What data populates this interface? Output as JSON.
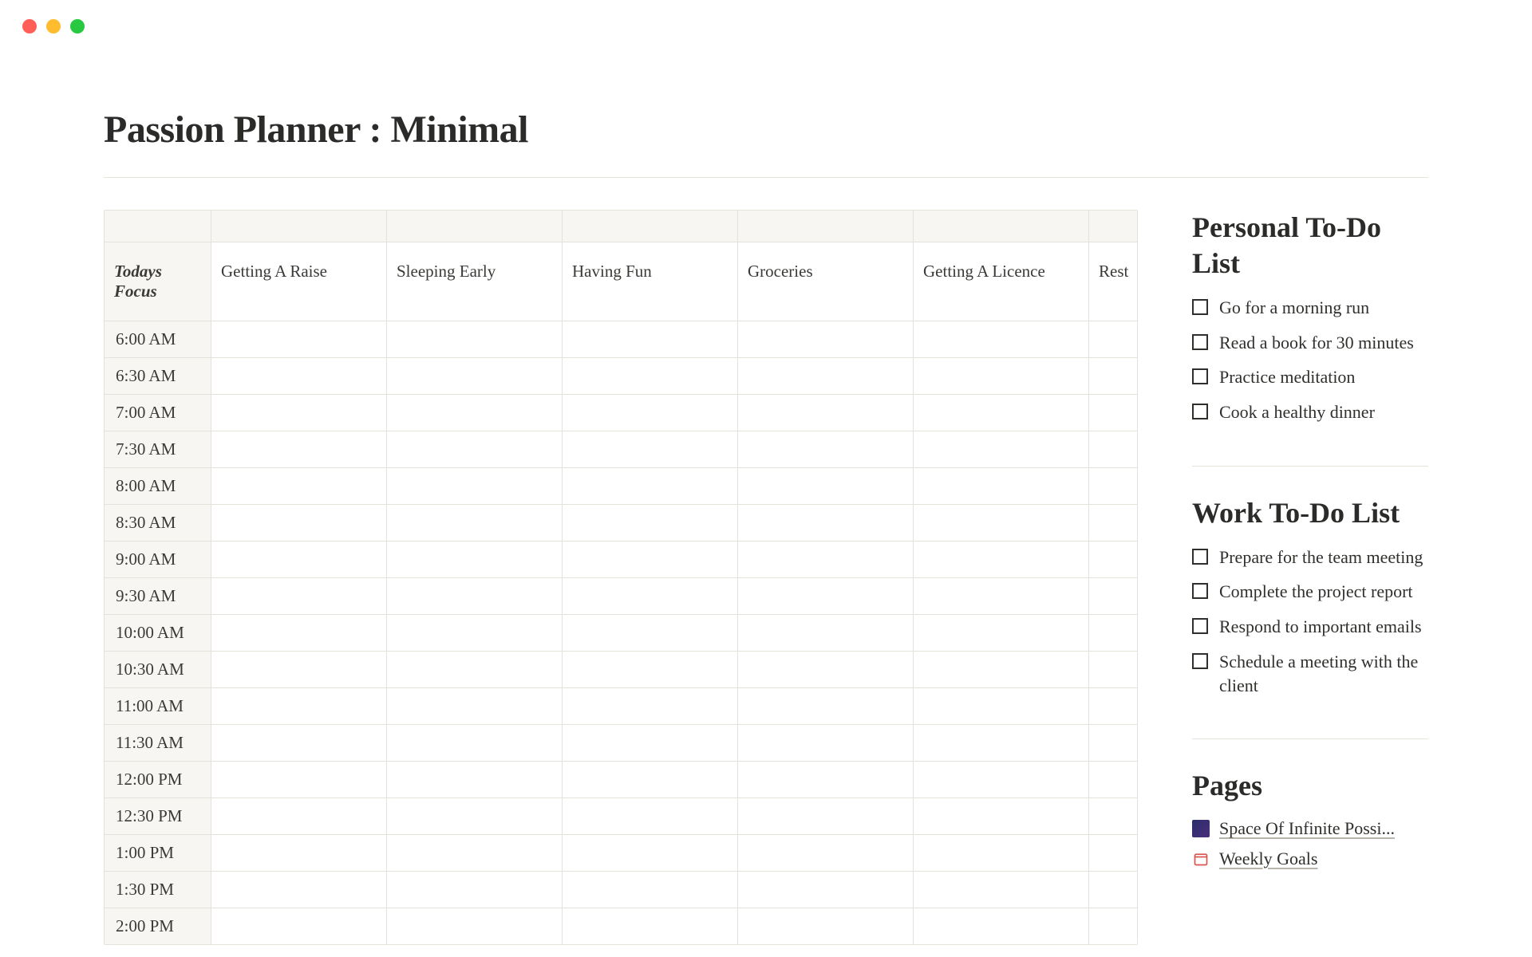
{
  "page": {
    "title": "Passion Planner : Minimal"
  },
  "schedule": {
    "focusLabel": "Todays Focus",
    "columns": [
      "Getting A Raise",
      "Sleeping Early",
      "Having Fun",
      "Groceries",
      "Getting A Licence",
      "Rest"
    ],
    "times": [
      "6:00 AM",
      "6:30 AM",
      "7:00 AM",
      "7:30 AM",
      "8:00 AM",
      "8:30 AM",
      "9:00 AM",
      "9:30 AM",
      "10:00 AM",
      "10:30 AM",
      "11:00 AM",
      "11:30 AM",
      "12:00 PM",
      "12:30 PM",
      "1:00 PM",
      "1:30 PM",
      "2:00 PM"
    ]
  },
  "personal": {
    "title": "Personal To-Do List",
    "items": [
      "Go for a morning run",
      "Read a book for 30 minutes",
      "Practice meditation",
      "Cook a healthy dinner"
    ]
  },
  "work": {
    "title": "Work To-Do List",
    "items": [
      "Prepare for the team meeting",
      "Complete the project report",
      "Respond to important emails",
      "Schedule a meeting with the client"
    ]
  },
  "pages": {
    "title": "Pages",
    "items": [
      {
        "label": "Space Of Infinite Possi...",
        "icon": "space"
      },
      {
        "label": "Weekly Goals",
        "icon": "weekly"
      }
    ]
  }
}
